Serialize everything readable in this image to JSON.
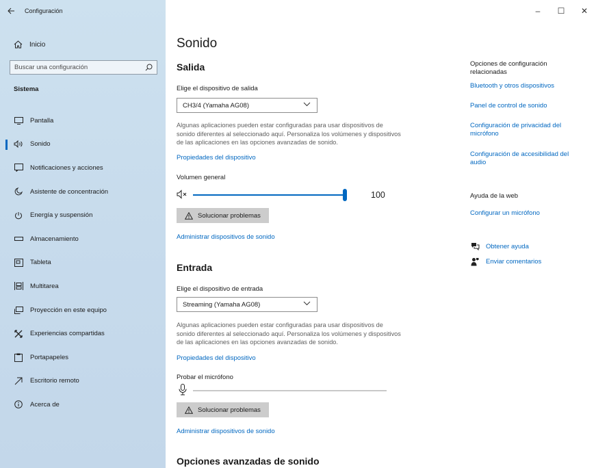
{
  "window": {
    "title": "Configuración",
    "minimize": "–",
    "maximize": "☐",
    "close": "✕"
  },
  "sidebar": {
    "home_label": "Inicio",
    "search_placeholder": "Buscar una configuración",
    "section": "Sistema",
    "items": [
      {
        "label": "Pantalla",
        "icon": "monitor-icon"
      },
      {
        "label": "Sonido",
        "icon": "speaker-icon",
        "active": true
      },
      {
        "label": "Notificaciones y acciones",
        "icon": "notification-icon"
      },
      {
        "label": "Asistente de concentración",
        "icon": "moon-icon"
      },
      {
        "label": "Energía y suspensión",
        "icon": "power-icon"
      },
      {
        "label": "Almacenamiento",
        "icon": "storage-icon"
      },
      {
        "label": "Tableta",
        "icon": "tablet-icon"
      },
      {
        "label": "Multitarea",
        "icon": "multitask-icon"
      },
      {
        "label": "Proyección en este equipo",
        "icon": "projection-icon"
      },
      {
        "label": "Experiencias compartidas",
        "icon": "shared-icon"
      },
      {
        "label": "Portapapeles",
        "icon": "clipboard-icon"
      },
      {
        "label": "Escritorio remoto",
        "icon": "remote-desktop-icon"
      },
      {
        "label": "Acerca de",
        "icon": "info-icon"
      }
    ]
  },
  "main": {
    "title": "Sonido",
    "output": {
      "heading": "Salida",
      "device_label": "Elige el dispositivo de salida",
      "device_value": "CH3/4 (Yamaha AG08)",
      "description": "Algunas aplicaciones pueden estar configuradas para usar dispositivos de sonido diferentes al seleccionado aquí. Personaliza los volúmenes y dispositivos de las aplicaciones en las opciones avanzadas de sonido.",
      "properties_link": "Propiedades del dispositivo",
      "volume_label": "Volumen general",
      "volume_value": "100",
      "volume_level": 100,
      "troubleshoot": "Solucionar problemas",
      "manage_link": "Administrar dispositivos de sonido"
    },
    "input": {
      "heading": "Entrada",
      "device_label": "Elige el dispositivo de entrada",
      "device_value": "Streaming (Yamaha AG08)",
      "description": "Algunas aplicaciones pueden estar configuradas para usar dispositivos de sonido diferentes al seleccionado aquí. Personaliza los volúmenes y dispositivos de las aplicaciones en las opciones avanzadas de sonido.",
      "properties_link": "Propiedades del dispositivo",
      "mic_test_label": "Probar el micrófono",
      "mic_level": 0,
      "troubleshoot": "Solucionar problemas",
      "manage_link": "Administrar dispositivos de sonido"
    },
    "advanced_heading": "Opciones avanzadas de sonido"
  },
  "related": {
    "heading": "Opciones de configuración relacionadas",
    "links": [
      "Bluetooth y otros dispositivos",
      "Panel de control de sonido",
      "Configuración de privacidad del micrófono",
      "Configuración de accesibilidad del audio"
    ],
    "web_help_heading": "Ayuda de la web",
    "web_help_link": "Configurar un micrófono",
    "get_help": "Obtener ayuda",
    "feedback": "Enviar comentarios"
  },
  "colors": {
    "accent": "#0067c0",
    "sidebar_bg": "#c9ddee",
    "button_bg": "#cccccc"
  }
}
